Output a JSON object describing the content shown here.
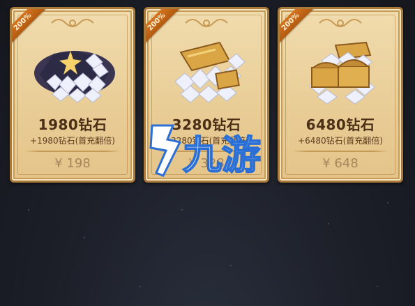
{
  "colors": {
    "card_bg": "#e8cc95",
    "card_border": "#a97a3a",
    "badge": "#c9661a",
    "title_text": "#4a2f16",
    "price_text": "#a8845a",
    "background": "#1c1f28"
  },
  "packages": [
    {
      "badge": "200%",
      "title": "1980钻石",
      "bonus": "+1980钻石(首充翻倍)",
      "price": "¥ 198",
      "icon": "diamond-pile-with-star-icon"
    },
    {
      "badge": "200%",
      "title": "3280钻石",
      "bonus": "+3280钻石(首充翻倍)",
      "price": "¥ 328",
      "icon": "diamond-chest-icon"
    },
    {
      "badge": "200%",
      "title": "6480钻石",
      "bonus": "+6480钻石(首充翻倍)",
      "price": "¥ 648",
      "icon": "diamond-treasure-chests-icon"
    }
  ],
  "watermark": {
    "text": "九游",
    "icon": "jiuyou-logo-icon"
  }
}
